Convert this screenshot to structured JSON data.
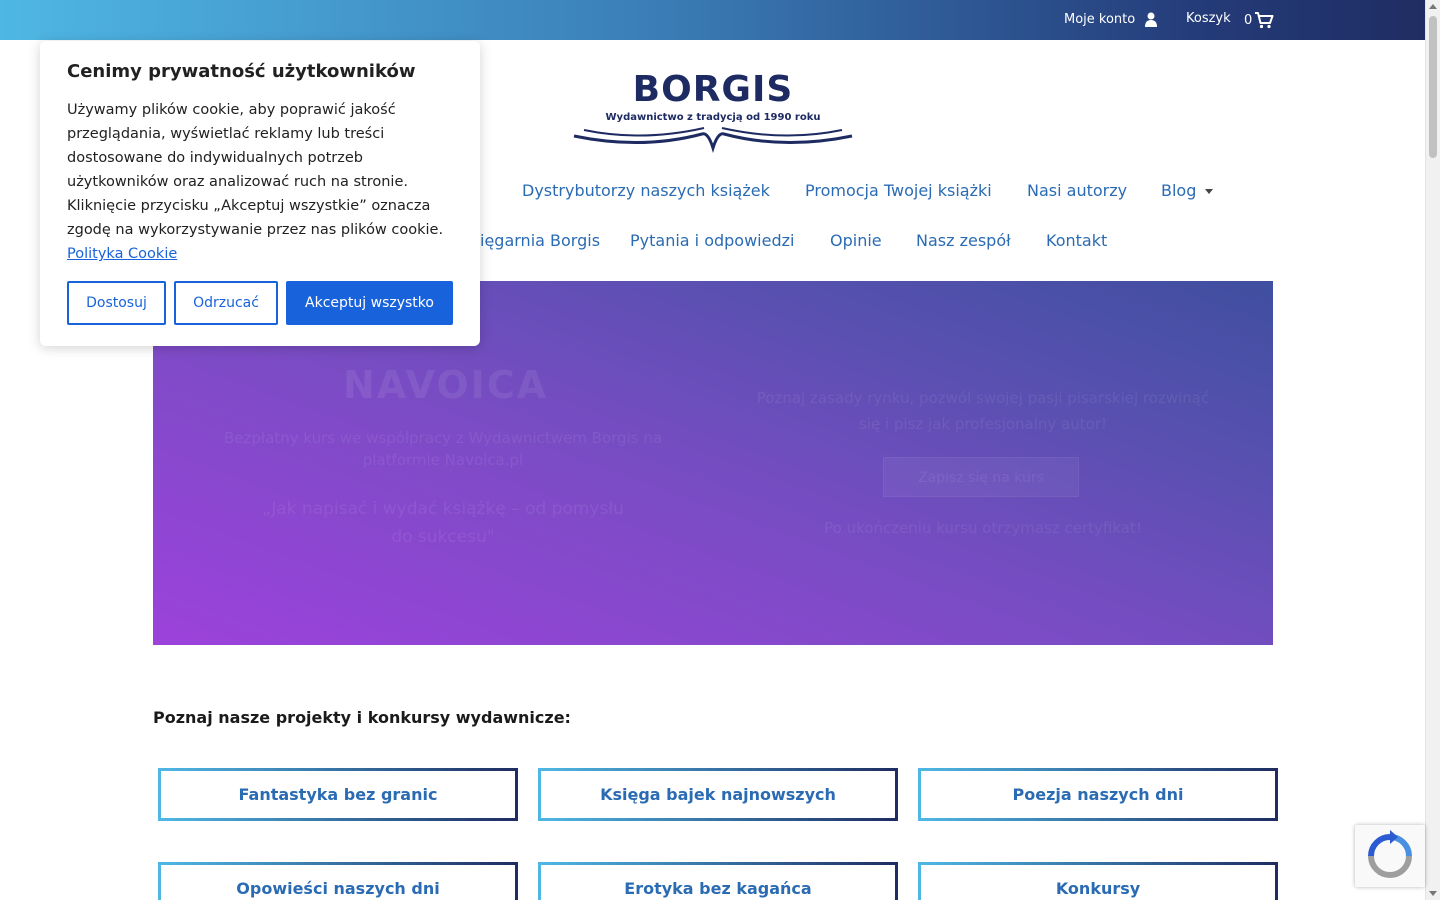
{
  "topbar": {
    "account_label": "Moje konto",
    "cart_label": "Koszyk",
    "cart_count": "0"
  },
  "logo": {
    "name": "BORGIS",
    "tagline": "Wydawnictwo z tradycją od 1990 roku"
  },
  "nav": {
    "row1": [
      {
        "label": "Dystrybutorzy naszych książek"
      },
      {
        "label": "Promocja Twojej książki"
      },
      {
        "label": "Nasi autorzy"
      },
      {
        "label": "Blog"
      }
    ],
    "row2": [
      {
        "label": "ięgarnia Borgis"
      },
      {
        "label": "Pytania i odpowiedzi"
      },
      {
        "label": "Opinie"
      },
      {
        "label": "Nasz zespół"
      },
      {
        "label": "Kontakt"
      }
    ]
  },
  "hero": {
    "brand": "NAVOICA",
    "left_text": "Bezpłatny kurs we współpracy z Wydawnictwem Borgis na platformie Navoica.pl",
    "left_quote": "„Jak napisać i wydać książkę – od pomysłu do sukcesu\"",
    "right_text": "Poznaj zasady rynku, pozwól swojej pasji pisarskiej rozwinąć się i pisz jak profesjonalny autor!",
    "button": "Zapisz się na kurs",
    "right_note": "Po ukończeniu kursu otrzymasz certyfikat!"
  },
  "cookie": {
    "title": "Cenimy prywatność użytkowników",
    "body": "Używamy plików cookie, aby poprawić jakość przeglądania, wyświetlać reklamy lub treści dostosowane do indywidualnych potrzeb użytkowników oraz analizować ruch na stronie. Kliknięcie przycisku „Akceptuj wszystkie” oznacza zgodę na wykorzystywanie przez nas plików cookie.",
    "link": "Polityka Cookie",
    "btn_customize": "Dostosuj",
    "btn_reject": "Odrzucać",
    "btn_accept": "Akceptuj wszystko"
  },
  "projects": {
    "title": "Poznaj nasze projekty i konkursy wydawnicze:",
    "items": [
      "Fantastyka bez granic",
      "Księga bajek najnowszych",
      "Poezja naszych dni",
      "Opowieści naszych dni",
      "Erotyka bez kagańca",
      "Konkursy"
    ]
  },
  "colors": {
    "accent": "#1863dc",
    "nav_link": "#2a6bb3",
    "brand_dark": "#1e2b62"
  }
}
